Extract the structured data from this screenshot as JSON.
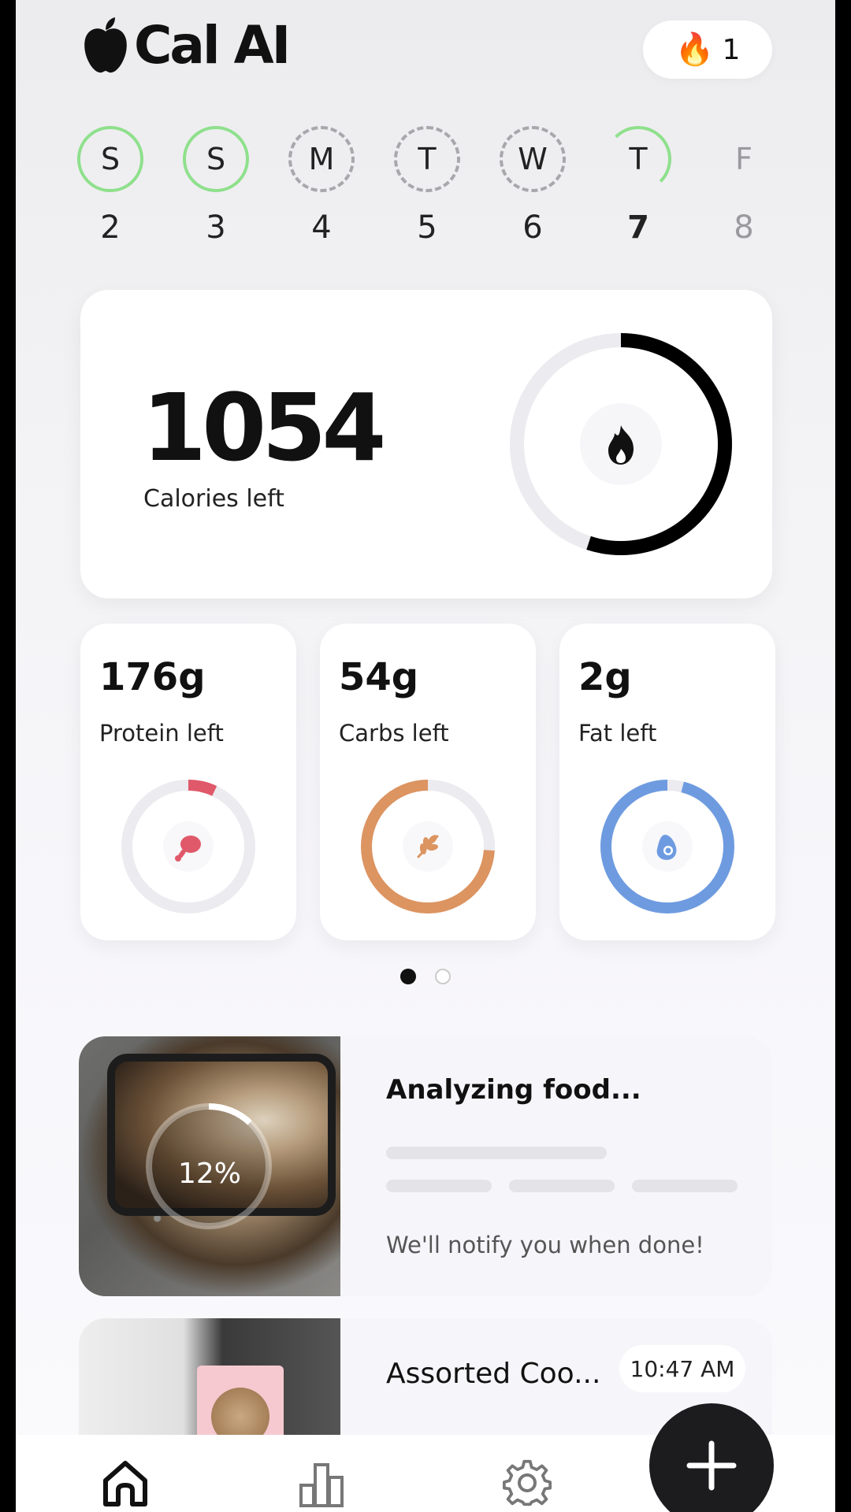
{
  "header": {
    "app_name": "Cal AI",
    "logo_icon": "apple-icon",
    "streak": {
      "icon": "🔥",
      "count": "1"
    }
  },
  "week": [
    {
      "letter": "S",
      "date": "2",
      "status": "complete"
    },
    {
      "letter": "S",
      "date": "3",
      "status": "complete"
    },
    {
      "letter": "M",
      "date": "4",
      "status": "missed"
    },
    {
      "letter": "T",
      "date": "5",
      "status": "missed"
    },
    {
      "letter": "W",
      "date": "6",
      "status": "missed"
    },
    {
      "letter": "T",
      "date": "7",
      "status": "today"
    },
    {
      "letter": "F",
      "date": "8",
      "status": "future"
    }
  ],
  "calories": {
    "value": "1054",
    "label": "Calories left",
    "progress_fraction": 0.55,
    "icon": "flame-icon"
  },
  "macros": [
    {
      "value": "176g",
      "label": "Protein left",
      "color": "#e0596a",
      "progress_fraction": 0.07,
      "icon": "drumstick-icon"
    },
    {
      "value": "54g",
      "label": "Carbs left",
      "color": "#dc9461",
      "progress_fraction": 0.74,
      "icon": "wheat-icon"
    },
    {
      "value": "2g",
      "label": "Fat left",
      "color": "#6e9be0",
      "progress_fraction": 0.96,
      "icon": "avocado-icon"
    }
  ],
  "pager": {
    "active": 0,
    "count": 2
  },
  "analyzing": {
    "title": "Analyzing food...",
    "percent": "12%",
    "progress_fraction": 0.12,
    "note": "We'll notify you when done!"
  },
  "entry": {
    "title": "Assorted Coo...",
    "time": "10:47 AM"
  },
  "tabbar": {
    "tabs": [
      "home-icon",
      "chart-icon",
      "settings-icon"
    ],
    "add_icon": "plus-icon"
  },
  "colors": {
    "green_ring": "#8fe08c",
    "dark": "#111111"
  }
}
